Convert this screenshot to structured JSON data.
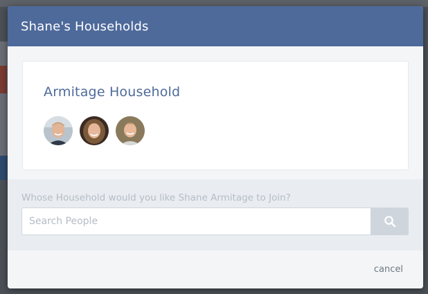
{
  "modal": {
    "title": "Shane's Households"
  },
  "household": {
    "name": "Armitage Household",
    "members": [
      {
        "avatar": "adult-male-avatar"
      },
      {
        "avatar": "adult-female-avatar"
      },
      {
        "avatar": "child-avatar"
      }
    ]
  },
  "join": {
    "prompt": "Whose Household would you like Shane Armitage to Join?",
    "search_placeholder": "Search People",
    "search_value": "",
    "search_button_icon": "search-icon"
  },
  "footer": {
    "cancel_label": "cancel"
  },
  "colors": {
    "header": "#4e6a9b",
    "household_name": "#4e6a9b",
    "prompt_text": "#b4bcc5",
    "search_button": "#cfd5dc"
  }
}
